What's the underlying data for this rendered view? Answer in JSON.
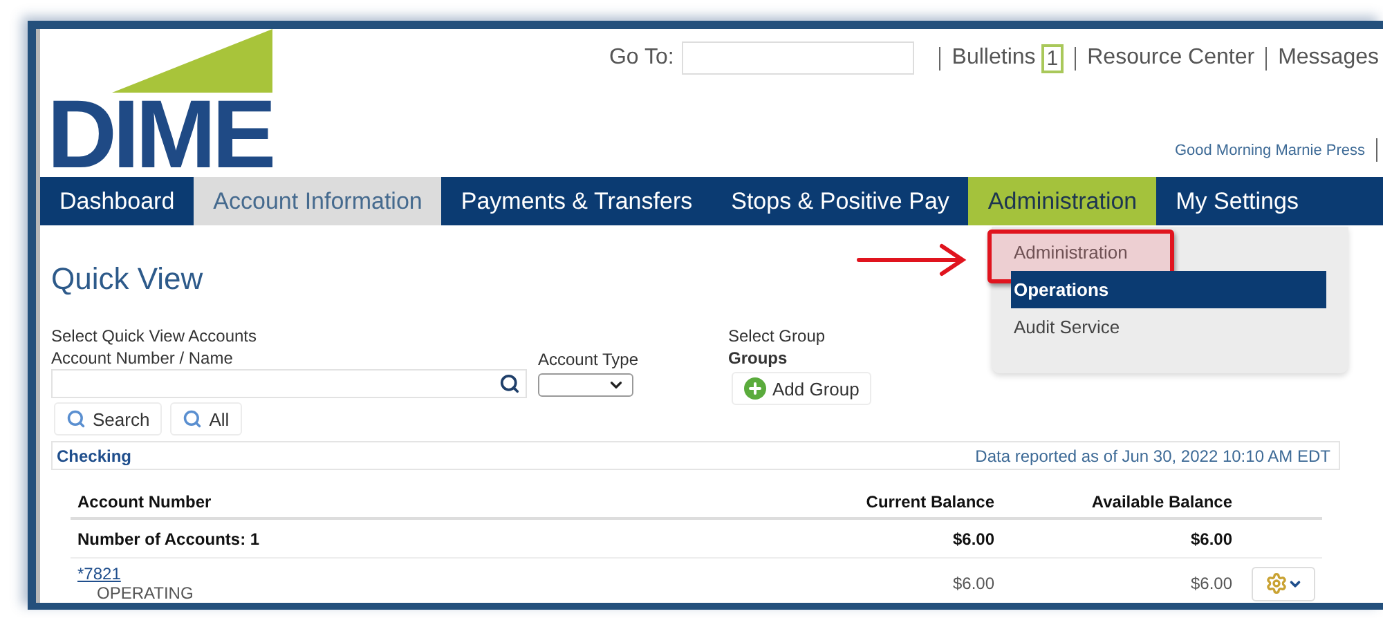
{
  "header": {
    "logo": "DIME",
    "goto_label": "Go To:",
    "links": [
      {
        "label": "Bulletins",
        "badge": "1"
      },
      {
        "label": "Resource Center"
      },
      {
        "label": "Messages"
      }
    ],
    "greeting": "Good Morning Marnie Press"
  },
  "nav": [
    {
      "label": "Dashboard",
      "selected": false,
      "open": false
    },
    {
      "label": "Account Information",
      "selected": true,
      "open": false
    },
    {
      "label": "Payments & Transfers",
      "selected": false,
      "open": false
    },
    {
      "label": "Stops & Positive Pay",
      "selected": false,
      "open": false
    },
    {
      "label": "Administration",
      "selected": false,
      "open": true
    },
    {
      "label": "My Settings",
      "selected": false,
      "open": false
    }
  ],
  "menu": [
    {
      "label": "Administration",
      "selected": false,
      "callout": true
    },
    {
      "label": "Operations",
      "selected": true,
      "callout": false
    },
    {
      "label": "Audit Service",
      "selected": false,
      "callout": false
    }
  ],
  "page_title": "Quick View",
  "filters": {
    "heading": "Select Quick View Accounts",
    "account_label": "Account Number / Name",
    "type_label": "Account Type",
    "group_heading": "Select Group",
    "group_label": "Groups",
    "add_group": "Add Group",
    "buttons": [
      "Search",
      "All"
    ]
  },
  "section": {
    "title": "Checking",
    "as_of": "Data reported as of Jun 30, 2022 10:10 AM EDT"
  },
  "table": {
    "columns": [
      "Account Number",
      "Current Balance",
      "Available Balance"
    ],
    "summary": {
      "label": "Number of Accounts: 1",
      "current": "$6.00",
      "available": "$6.00"
    },
    "rows": [
      {
        "account": "*7821",
        "name": "OPERATING",
        "current": "$6.00",
        "available": "$6.00"
      }
    ]
  }
}
